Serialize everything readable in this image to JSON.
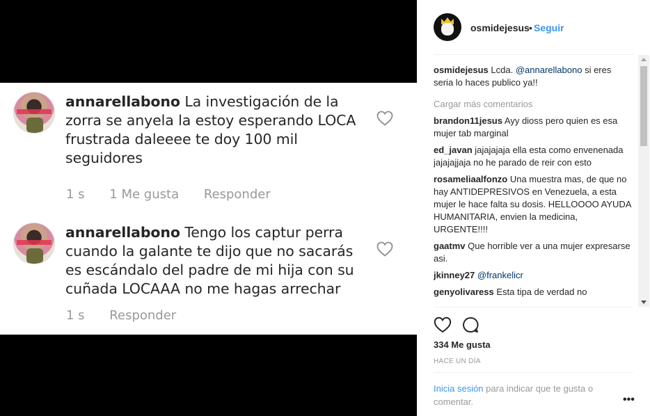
{
  "media": {
    "comments": [
      {
        "username": "annarellabono",
        "text": "La investigación de la zorra se anyela la estoy esperando LOCA frustrada daleeee te doy 100 mil seguidores",
        "time": "1 s",
        "likes": "1 Me gusta",
        "reply": "Responder"
      },
      {
        "username": "annarellabono",
        "text": "Tengo los captur perra cuando la galante te dijo que no sacarás es escándalo del padre de mi hija con su cuñada LOCAAA no me hagas arrechar",
        "time": "1 s",
        "reply": "Responder"
      }
    ]
  },
  "header": {
    "username": "osmidejesus",
    "separator": "•",
    "follow": "Seguir"
  },
  "caption": {
    "username": "osmidejesus",
    "text_before": "Lcda.",
    "mention": "@annarellabono",
    "text_after": "si eres seria lo haces publico ya!!"
  },
  "load_more": "Cargar más comentarios",
  "comments": [
    {
      "username": "brandon11jesus",
      "text": "Ayy dioss pero quien es esa mujer tab marginal"
    },
    {
      "username": "ed_javan",
      "text": "jajajajaja ella esta como envenenada jajajajjaja no he parado de reir con esto"
    },
    {
      "username": "rosameliaalfonzo",
      "text": "Una muestra mas, de que no hay ANTIDEPRESIVOS en Venezuela, a esta mujer le hace falta su dosis. HELLOOOO AYUDA HUMANITARIA, envien la medicina, URGENTE!!!!"
    },
    {
      "username": "gaatmv",
      "text": "Que horrible ver a una mujer expresarse asi."
    },
    {
      "username": "jkinney27",
      "mention": "@frankelicr"
    },
    {
      "username": "genyolivaress",
      "text": "Esta tipa de verdad no"
    }
  ],
  "likes": "334 Me gusta",
  "time_ago": "HACE UN DÍA",
  "login": {
    "link": "Inicia sesión",
    "text": "para indicar que te gusta o comentar."
  },
  "more_label": "•••",
  "colors": {
    "link": "#3897f0",
    "mention": "#003569",
    "muted": "#999999",
    "text": "#262626"
  },
  "icons": [
    "heart-icon",
    "comment-icon",
    "more-options-icon"
  ]
}
